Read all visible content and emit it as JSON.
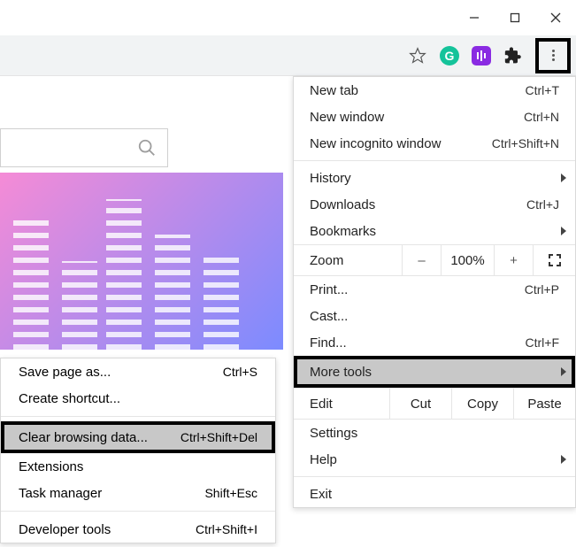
{
  "window": {
    "minimize": "–",
    "maximize": "☐",
    "close": "✕"
  },
  "toolbar": {
    "star": "star-icon",
    "grammarly_label": "G",
    "purple_ext": "db-extension-icon",
    "puzzle": "extensions-icon",
    "kebab": "chrome-menu-icon"
  },
  "menu": {
    "new_tab": {
      "label": "New tab",
      "shortcut": "Ctrl+T"
    },
    "new_window": {
      "label": "New window",
      "shortcut": "Ctrl+N"
    },
    "new_incognito": {
      "label": "New incognito window",
      "shortcut": "Ctrl+Shift+N"
    },
    "history": {
      "label": "History"
    },
    "downloads": {
      "label": "Downloads",
      "shortcut": "Ctrl+J"
    },
    "bookmarks": {
      "label": "Bookmarks"
    },
    "zoom": {
      "label": "Zoom",
      "minus": "–",
      "pct": "100%",
      "plus": "+"
    },
    "print": {
      "label": "Print...",
      "shortcut": "Ctrl+P"
    },
    "cast": {
      "label": "Cast..."
    },
    "find": {
      "label": "Find...",
      "shortcut": "Ctrl+F"
    },
    "more_tools": {
      "label": "More tools"
    },
    "edit": {
      "label": "Edit",
      "cut": "Cut",
      "copy": "Copy",
      "paste": "Paste"
    },
    "settings": {
      "label": "Settings"
    },
    "help": {
      "label": "Help"
    },
    "exit": {
      "label": "Exit"
    }
  },
  "submenu": {
    "save_page": {
      "label": "Save page as...",
      "shortcut": "Ctrl+S"
    },
    "create_sc": {
      "label": "Create shortcut..."
    },
    "clear_data": {
      "label": "Clear browsing data...",
      "shortcut": "Ctrl+Shift+Del"
    },
    "extensions": {
      "label": "Extensions"
    },
    "task_mgr": {
      "label": "Task manager",
      "shortcut": "Shift+Esc"
    },
    "dev_tools": {
      "label": "Developer tools",
      "shortcut": "Ctrl+Shift+I"
    }
  }
}
